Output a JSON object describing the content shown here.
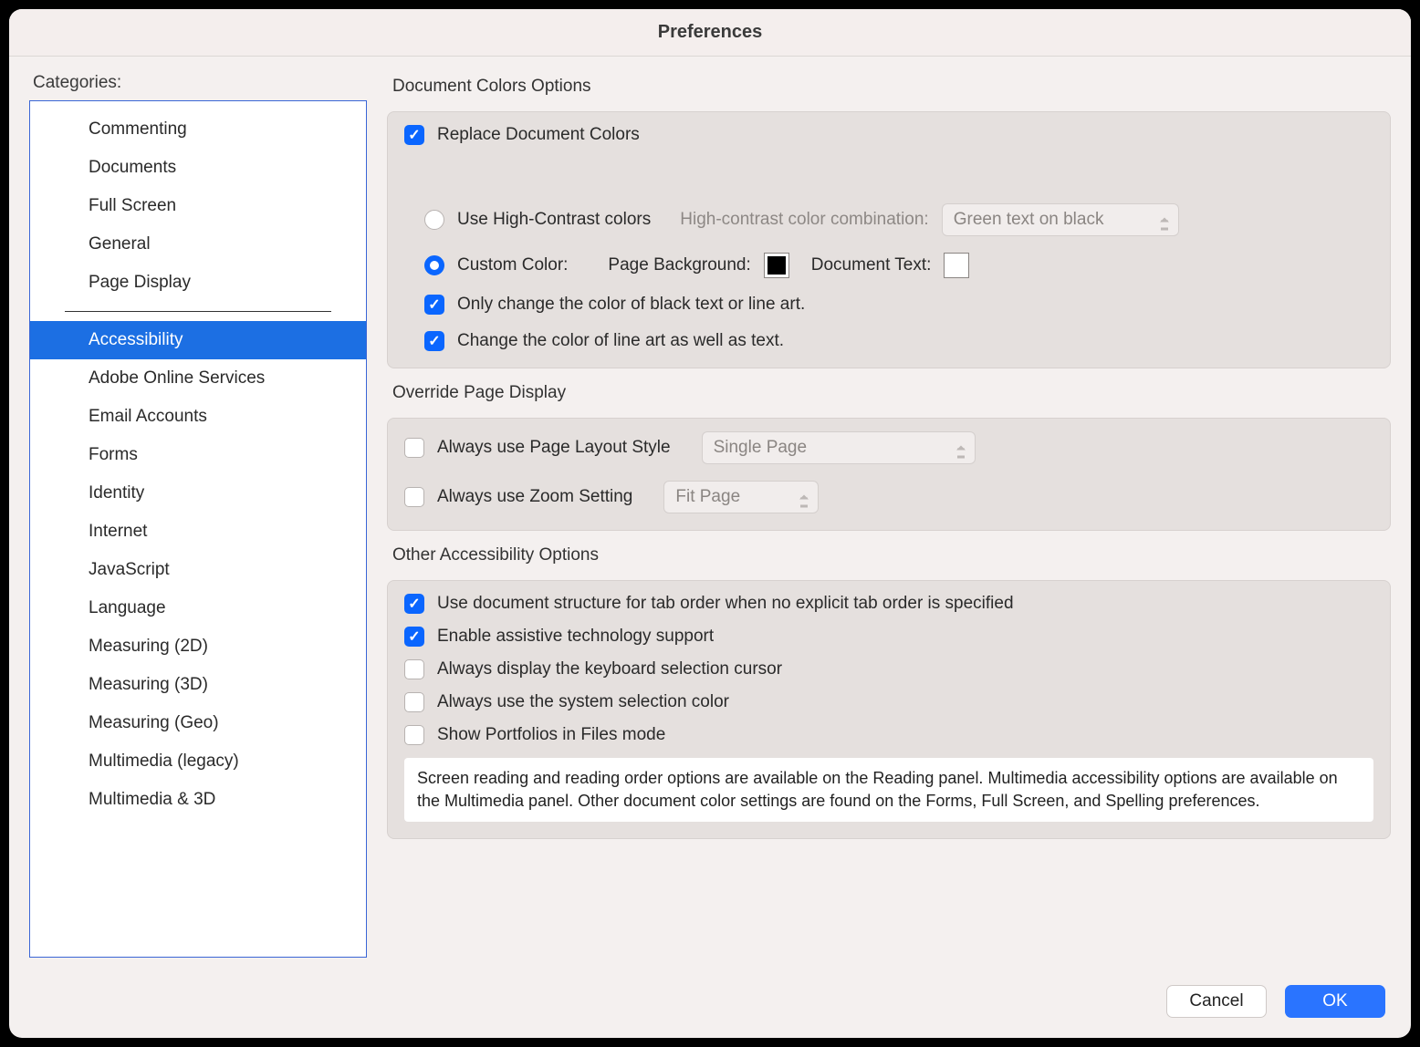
{
  "title": "Preferences",
  "sidebar": {
    "label": "Categories:",
    "items": [
      "Commenting",
      "Documents",
      "Full Screen",
      "General",
      "Page Display",
      "Accessibility",
      "Adobe Online Services",
      "Email Accounts",
      "Forms",
      "Identity",
      "Internet",
      "JavaScript",
      "Language",
      "Measuring (2D)",
      "Measuring (3D)",
      "Measuring (Geo)",
      "Multimedia (legacy)",
      "Multimedia & 3D"
    ],
    "selected": "Accessibility"
  },
  "doc_colors": {
    "title": "Document Colors Options",
    "replace_label": "Replace Document Colors",
    "replace_checked": true,
    "high_contrast_label": "Use High-Contrast colors",
    "high_contrast_selected": false,
    "high_contrast_combo_label": "High-contrast color combination:",
    "high_contrast_combo_value": "Green text on black",
    "custom_color_label": "Custom Color:",
    "custom_color_selected": true,
    "page_background_label": "Page Background:",
    "page_background_color": "#000000",
    "document_text_label": "Document Text:",
    "document_text_color": "#ffffff",
    "only_black_label": "Only change the color of black text or line art.",
    "only_black_checked": true,
    "line_art_label": "Change the color of line art as well as text.",
    "line_art_checked": true
  },
  "page_display": {
    "title": "Override Page Display",
    "layout_label": "Always use Page Layout Style",
    "layout_checked": false,
    "layout_value": "Single Page",
    "zoom_label": "Always use Zoom Setting",
    "zoom_checked": false,
    "zoom_value": "Fit Page"
  },
  "other": {
    "title": "Other Accessibility Options",
    "tab_order_label": "Use document structure for tab order when no explicit tab order is specified",
    "tab_order_checked": true,
    "assistive_label": "Enable assistive technology support",
    "assistive_checked": true,
    "kb_cursor_label": "Always display the keyboard selection cursor",
    "kb_cursor_checked": false,
    "sys_sel_label": "Always use the system selection color",
    "sys_sel_checked": false,
    "portfolios_label": "Show Portfolios in Files mode",
    "portfolios_checked": false,
    "info_text": "Screen reading and reading order options are available on the Reading panel. Multimedia accessibility options are available on the Multimedia panel. Other document color settings are found on the Forms, Full Screen, and Spelling preferences."
  },
  "footer": {
    "cancel": "Cancel",
    "ok": "OK"
  }
}
